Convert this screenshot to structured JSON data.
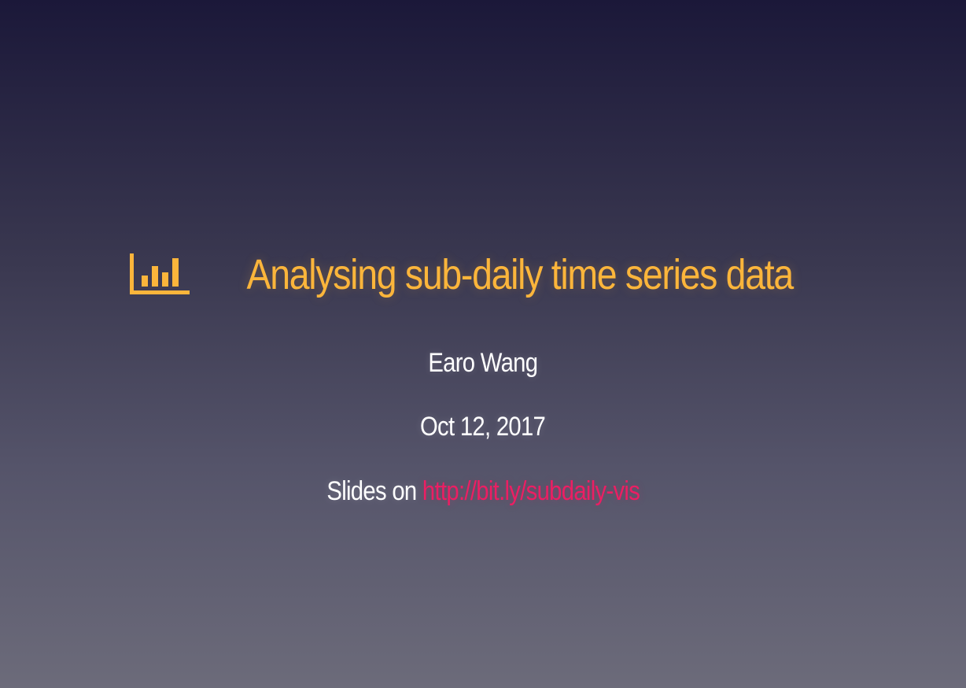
{
  "slide": {
    "title": "Analysing sub-daily time series data",
    "title_icon": "bar-chart-icon",
    "author": "Earo Wang",
    "date": "Oct 12, 2017",
    "slides_prefix": "Slides on",
    "slides_link": "http://bit.ly/subdaily-vis"
  },
  "colors": {
    "title": "#fbb53b",
    "text": "#ffffff",
    "link": "#ec1e63",
    "background_top": "#1b1839",
    "background_bottom": "#6c6b7a"
  }
}
